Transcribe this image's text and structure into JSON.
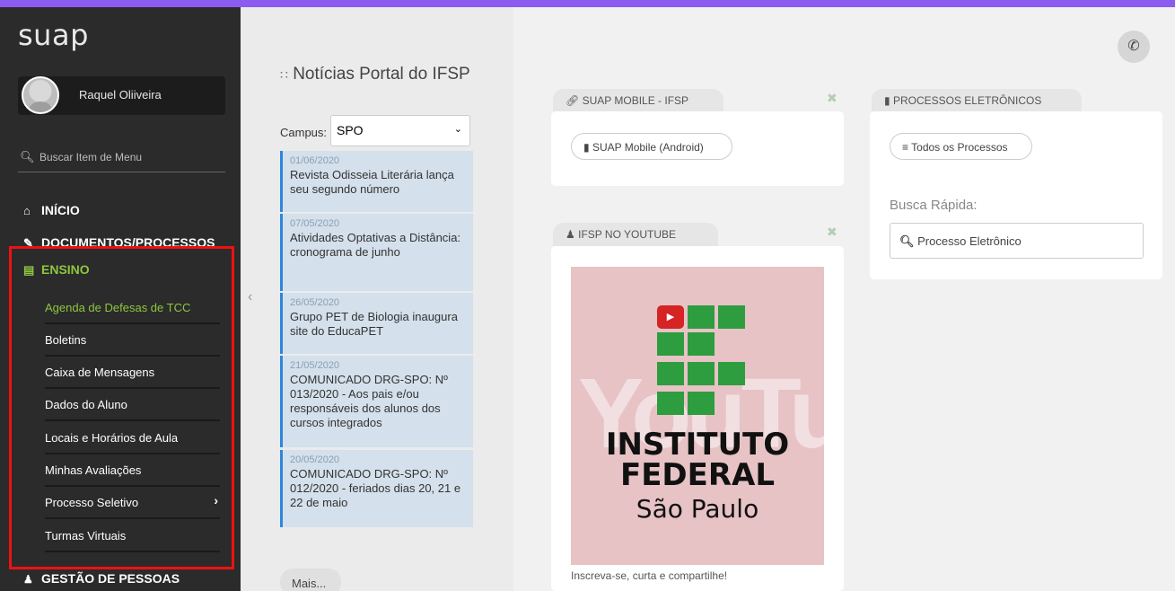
{
  "sidebar": {
    "logo": "suap",
    "user_name": "Raquel Oliiveira",
    "search_label": "Buscar Item de Menu",
    "menu": [
      {
        "label": "INÍCIO",
        "icon": "home-icon"
      },
      {
        "label": "DOCUMENTOS/PROCESSOS",
        "icon": "document-edit-icon"
      },
      {
        "label": "ENSINO",
        "icon": "chalkboard-icon"
      },
      {
        "label": "GESTÃO DE PESSOAS",
        "icon": "users-icon"
      }
    ],
    "ensino_items": [
      "Agenda de Defesas de TCC",
      "Boletins",
      "Caixa de Mensagens",
      "Dados do Aluno",
      "Locais e Horários de Aula",
      "Minhas Avaliações",
      "Processo Seletivo",
      "Turmas Virtuais"
    ],
    "accent_color": "#8ec63f"
  },
  "news": {
    "title": "Notícias Portal do IFSP",
    "campus_label": "Campus:",
    "campus_value": "SPO",
    "items": [
      {
        "date": "01/06/2020",
        "text": "Revista Odisseia Literária lança seu segundo número"
      },
      {
        "date": "07/05/2020",
        "text": "Atividades Optativas a Distância: cronograma de junho"
      },
      {
        "date": "26/05/2020",
        "text": "Grupo PET de Biologia inaugura site do EducaPET"
      },
      {
        "date": "21/05/2020",
        "text": "COMUNICADO DRG-SPO: Nº 013/2020 - Aos pais e/ou responsáveis dos alunos dos cursos integrados"
      },
      {
        "date": "20/05/2020",
        "text": "COMUNICADO DRG-SPO: Nº 012/2020 - feriados dias 20, 21 e 22 de maio"
      }
    ],
    "more": "Mais..."
  },
  "cards": {
    "mobile": {
      "title": "SUAP MOBILE - IFSP",
      "button": "SUAP Mobile (Android)"
    },
    "youtube": {
      "title": "IFSP NO YOUTUBE",
      "thumb_line1": "INSTITUTO",
      "thumb_line2": "FEDERAL",
      "thumb_line3": "São Paulo",
      "caption": "Inscreva-se, curta e compartilhe!"
    },
    "processos": {
      "title": "PROCESSOS ELETRÔNICOS",
      "button": "Todos os Processos",
      "busca_label": "Busca Rápida:",
      "busca_placeholder": "Processo Eletrônico"
    }
  }
}
